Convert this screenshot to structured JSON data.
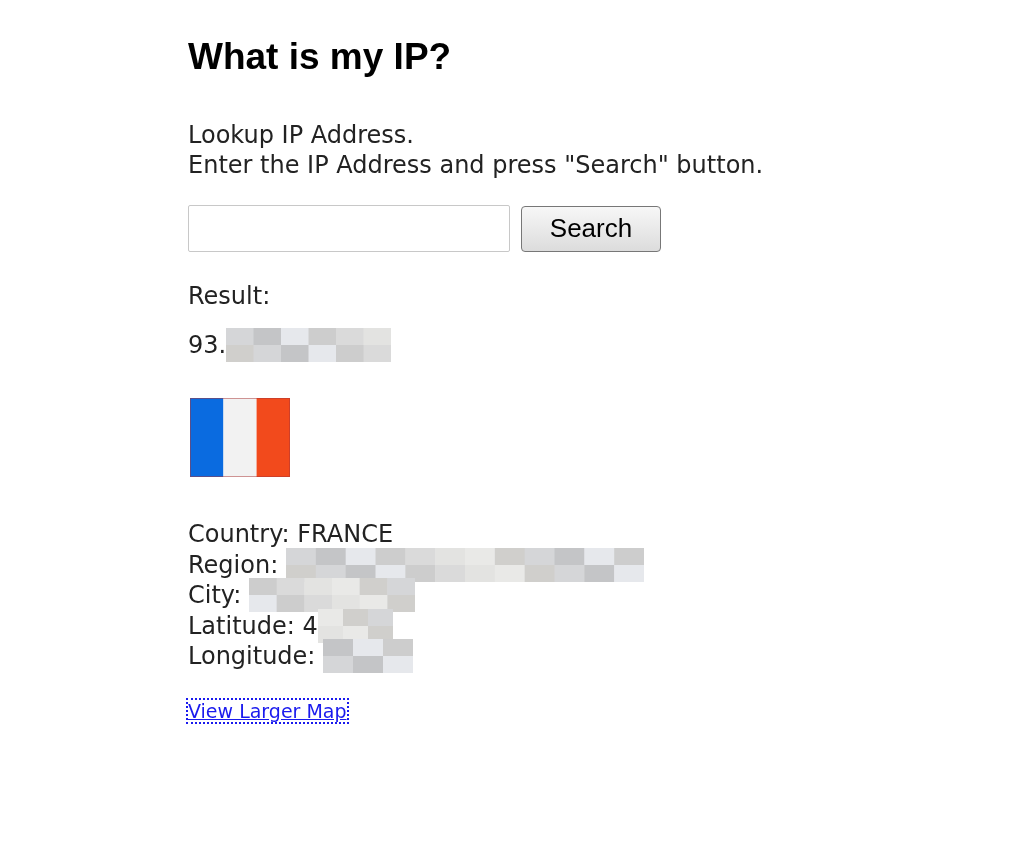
{
  "heading": "What is my IP?",
  "intro": [
    "Lookup IP Address.",
    "Enter the IP Address and press \"Search\" button."
  ],
  "search": {
    "button": "Search"
  },
  "result_label": "Result:",
  "ip": {
    "text": "93.",
    "redacted": true
  },
  "flag": {
    "kind": "tricolor"
  },
  "details": [
    {
      "label": "Country: FRANCE",
      "redacted": false
    },
    {
      "label": "Region: ",
      "redacted": true
    },
    {
      "label": "City: ",
      "redacted": true
    },
    {
      "label": "Latitude: 4",
      "redacted": true
    },
    {
      "label": "Longitude: ",
      "redacted": true
    }
  ],
  "map_link": {
    "label": "View Larger Map",
    "focused": true
  }
}
